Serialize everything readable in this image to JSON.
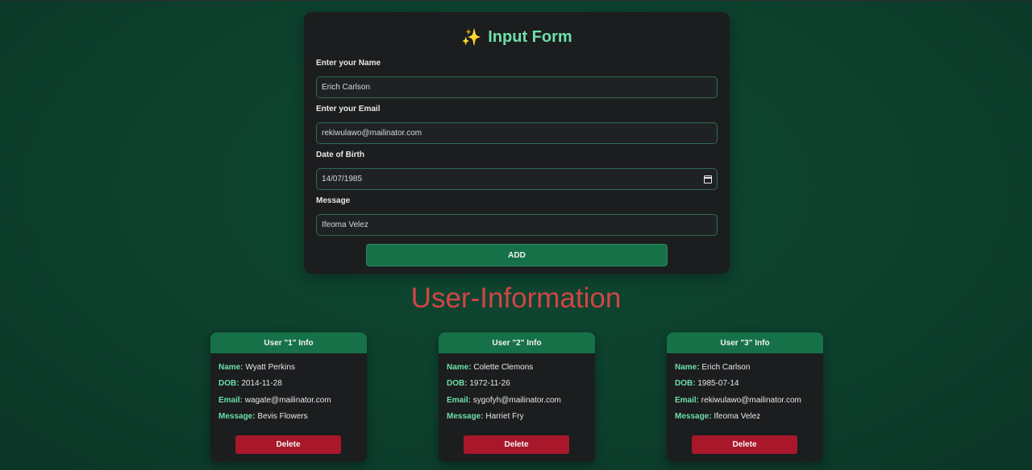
{
  "form": {
    "title_icon": "✨",
    "title": "Input Form",
    "name_label": "Enter your Name",
    "name_value": "Erich Carlson",
    "email_label": "Enter your Email",
    "email_value": "rekiwulawo@mailinator.com",
    "dob_label": "Date of Birth",
    "dob_value": "14/07/1985",
    "message_label": "Message",
    "message_value": "Ifeoma Velez",
    "add_label": "ADD"
  },
  "section_title": "User-Information",
  "field_keys": {
    "name": "Name:",
    "dob": "DOB:",
    "email": "Email:",
    "message": "Message:"
  },
  "users": [
    {
      "header": "User \"1\" Info",
      "name": "Wyatt Perkins",
      "dob": "2014-11-28",
      "email": "wagate@mailinator.com",
      "message": "Bevis Flowers",
      "delete_label": "Delete"
    },
    {
      "header": "User \"2\" Info",
      "name": "Colette Clemons",
      "dob": "1972-11-26",
      "email": "sygofyh@mailinator.com",
      "message": "Harriet Fry",
      "delete_label": "Delete"
    },
    {
      "header": "User \"3\" Info",
      "name": "Erich Carlson",
      "dob": "1985-07-14",
      "email": "rekiwulawo@mailinator.com",
      "message": "Ifeoma Velez",
      "delete_label": "Delete"
    }
  ],
  "colors": {
    "accent_green": "#177148",
    "label_green": "#6ee0a8",
    "heading_red": "#d24545",
    "delete_red": "#a8182a",
    "card_bg": "#1b1d1f"
  }
}
